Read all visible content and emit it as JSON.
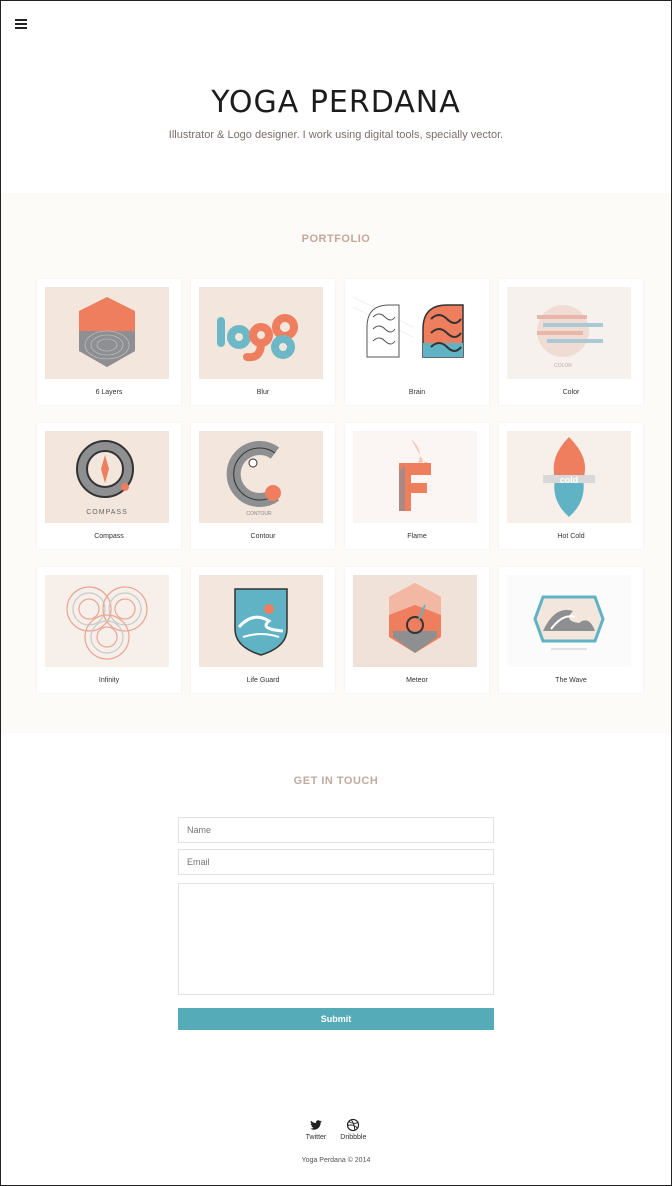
{
  "header": {
    "title": "YOGA PERDANA",
    "tagline": "Illustrator & Logo designer. I work using digital tools, specially vector."
  },
  "portfolio": {
    "title": "PORTFOLIO",
    "items": [
      {
        "label": "6 Layers",
        "icon": "hexagon-layers"
      },
      {
        "label": "Blur",
        "icon": "logo-wordmark"
      },
      {
        "label": "Brain",
        "icon": "brain"
      },
      {
        "label": "Color",
        "icon": "color-stripes"
      },
      {
        "label": "Compass",
        "icon": "compass",
        "art_text": "COMPASS"
      },
      {
        "label": "Contour",
        "icon": "contour-c",
        "art_text": "CONTOUR"
      },
      {
        "label": "Flame",
        "icon": "flame-f"
      },
      {
        "label": "Hot Cold",
        "icon": "hot-cold"
      },
      {
        "label": "Infinity",
        "icon": "infinity-rings"
      },
      {
        "label": "Life Guard",
        "icon": "wave-shield"
      },
      {
        "label": "Meteor",
        "icon": "meteor-hexagon"
      },
      {
        "label": "The Wave",
        "icon": "wave-badge"
      }
    ]
  },
  "contact": {
    "title": "GET IN TOUCH",
    "name_placeholder": "Name",
    "email_placeholder": "Email",
    "message_placeholder": "",
    "submit_label": "Submit"
  },
  "footer": {
    "twitter_label": "Twitter",
    "dribbble_label": "Dribbble",
    "copyright": "Yoga Perdana © 2014"
  },
  "colors": {
    "accent": "#56abb8",
    "coral": "#ee7e5e",
    "section_title": "#c4a798",
    "thumb_bg": "#f2e6dd"
  }
}
